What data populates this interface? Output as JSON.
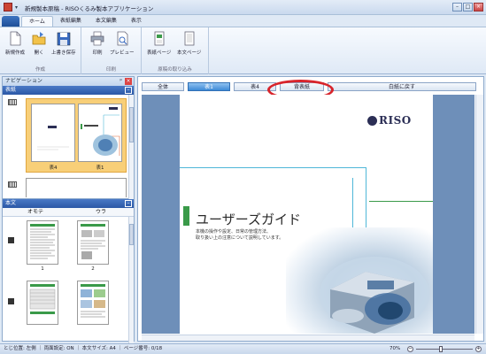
{
  "window": {
    "title": "新規製本原稿 - RISOくるみ製本アプリケーション",
    "qat_glyph": "▾",
    "minimize": "–",
    "maximize": "□",
    "close": "×"
  },
  "ribbon_tabs": [
    "ホーム",
    "表紙編集",
    "本文編集",
    "表示"
  ],
  "ribbon": {
    "groups": [
      {
        "label": "作成",
        "buttons": [
          "新規作成",
          "開く",
          "上書き保存"
        ]
      },
      {
        "label": "印刷",
        "buttons": [
          "印刷",
          "プレビュー"
        ]
      },
      {
        "label": "原稿の取り込み",
        "buttons": [
          "表紙ページ",
          "本文ページ"
        ]
      }
    ]
  },
  "nav": {
    "title": "ナビゲーション",
    "pin_glyph": "ᵖ",
    "close_glyph": "×",
    "collapse_glyph": "–",
    "cover_section": "表紙",
    "cover_pages": [
      "表4",
      "表1"
    ],
    "body_section": "本文",
    "body_columns": [
      "オモテ",
      "ウラ"
    ],
    "body_pages": [
      "1",
      "2"
    ]
  },
  "view_tabs": {
    "all": "全体",
    "front": "表1",
    "back": "表4",
    "spine": "背表紙",
    "reset": "白紙に戻す",
    "active": "表1",
    "highlighted": "背表紙"
  },
  "document": {
    "brand": "RISO",
    "heading": "ユーザーズガイド",
    "subtext": "本機の操作や設定、日常の管理方法、\n取り扱い上の注意について説明しています。"
  },
  "status": {
    "text": "とじ位置: 左側 ｜ 両面設定: ON ｜ 本文サイズ: A4 ｜ ページ番号: 0/18",
    "zoom": "70%",
    "zoom_out": "−",
    "zoom_in": "+"
  },
  "colors": {
    "accent_blue": "#2b58a6",
    "highlight_red": "#d8242b",
    "selection_orange": "#f8cf78",
    "brand_green": "#3a9a49"
  }
}
